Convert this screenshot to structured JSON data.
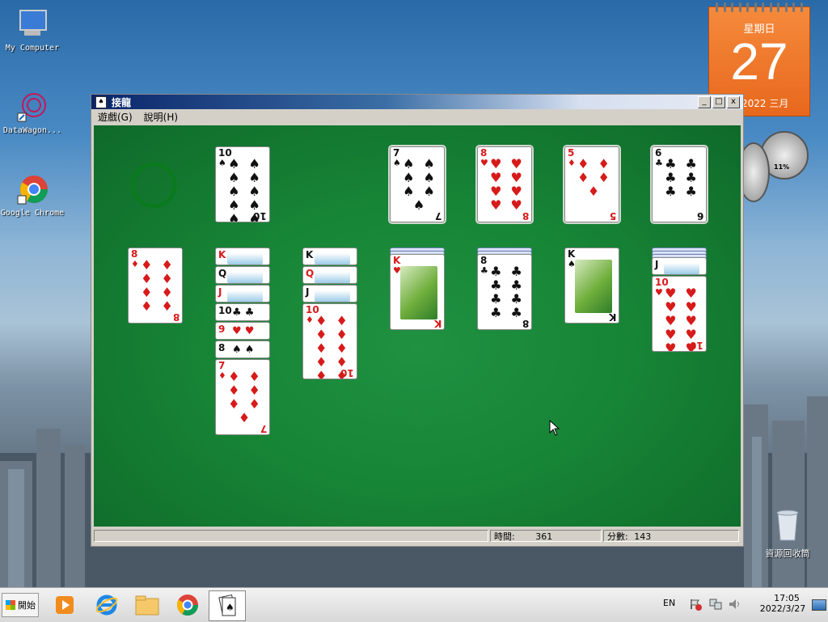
{
  "desktop": {
    "icons": [
      {
        "label": "My Computer"
      },
      {
        "label": "DataWagon..."
      },
      {
        "label": "Google Chrome"
      }
    ],
    "recycle_bin_label": "資源回收筒",
    "calendar": {
      "weekday": "星期日",
      "day": "27",
      "year_month": "2022 三月"
    },
    "meter_reading": "11%"
  },
  "window": {
    "title": "接龍",
    "menu": [
      "遊戲(G)",
      "說明(H)"
    ],
    "controls": {
      "minimize": "_",
      "maximize": "□",
      "close": "x"
    },
    "status": {
      "time_label": "時間:",
      "time_value": "361",
      "score_label": "分數:",
      "score_value": "143"
    }
  },
  "game": {
    "stock": {
      "state": "empty (recycle circle)"
    },
    "waste": {
      "rank": "10",
      "suit": "♠",
      "color": "black"
    },
    "foundations": [
      {
        "rank": "7",
        "suit": "♠",
        "color": "black"
      },
      {
        "rank": "8",
        "suit": "♥",
        "color": "red"
      },
      {
        "rank": "5",
        "suit": "♦",
        "color": "red"
      },
      {
        "rank": "6",
        "suit": "♣",
        "color": "black"
      }
    ],
    "tableau": [
      {
        "cards": [
          {
            "rank": "8",
            "suit": "♦",
            "color": "red"
          }
        ]
      },
      {
        "cards": [
          {
            "rank": "K",
            "suit": "♥",
            "color": "red"
          },
          {
            "rank": "Q",
            "suit": "♠",
            "color": "black"
          },
          {
            "rank": "J",
            "suit": "♥",
            "color": "red"
          },
          {
            "rank": "10",
            "suit": "♣",
            "color": "black"
          },
          {
            "rank": "9",
            "suit": "♥",
            "color": "red"
          },
          {
            "rank": "8",
            "suit": "♠",
            "color": "black"
          },
          {
            "rank": "7",
            "suit": "♦",
            "color": "red"
          }
        ]
      },
      {
        "cards": [
          {
            "rank": "K",
            "suit": "♠",
            "color": "black"
          },
          {
            "rank": "Q",
            "suit": "♥",
            "color": "red"
          },
          {
            "rank": "J",
            "suit": "♠",
            "color": "black"
          },
          {
            "rank": "10",
            "suit": "♦",
            "color": "red"
          }
        ]
      },
      {
        "cards": [
          {
            "rank": "K",
            "suit": "♥",
            "color": "red"
          }
        ]
      },
      {
        "cards": [
          {
            "rank": "8",
            "suit": "♣",
            "color": "black"
          }
        ]
      },
      {
        "cards": [
          {
            "rank": "K",
            "suit": "♠",
            "color": "black"
          }
        ]
      },
      {
        "cards": [
          {
            "rank": "J",
            "suit": "♠",
            "color": "black"
          },
          {
            "rank": "10",
            "suit": "♥",
            "color": "red"
          }
        ]
      }
    ]
  },
  "taskbar": {
    "start_label": "開始",
    "lang": "EN",
    "clock_time": "17:05",
    "clock_date": "2022/3/27"
  }
}
